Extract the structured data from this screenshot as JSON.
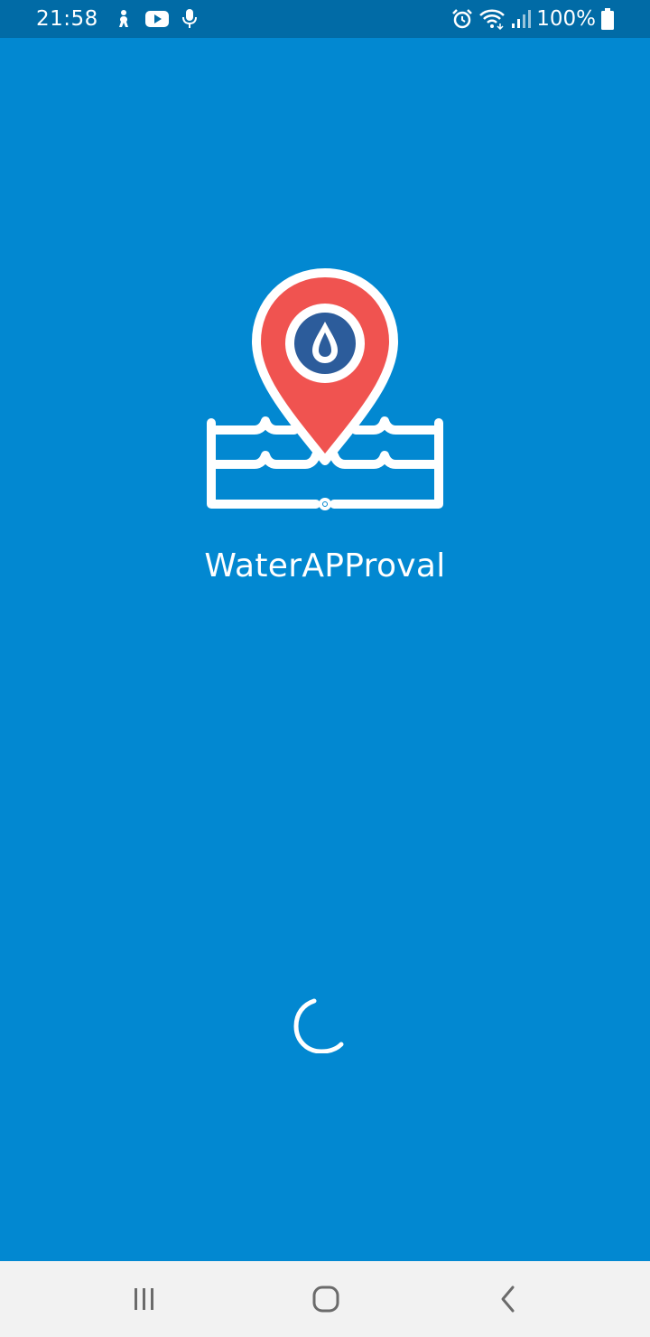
{
  "status_bar": {
    "time": "21:58",
    "left_icons": [
      "accessibility-icon",
      "youtube-icon",
      "microphone-icon"
    ],
    "right_icons": [
      "alarm-icon",
      "wifi-icon",
      "signal-icon",
      "battery-icon"
    ],
    "battery_percent": "100%"
  },
  "splash": {
    "app_name": "WaterAPProval",
    "logo_icon": "water-location-pin-icon",
    "loading_indicator": "spinner-icon"
  },
  "nav_bar": {
    "buttons": [
      "recent-apps-icon",
      "home-icon",
      "back-icon"
    ]
  },
  "colors": {
    "background": "#0288d1",
    "status_bar": "#016ba6",
    "pin_red": "#f05350",
    "pin_inner_blue": "#2c5c9b",
    "white": "#ffffff",
    "nav_bar": "#f2f2f2",
    "nav_icon": "#6b6b6b"
  }
}
